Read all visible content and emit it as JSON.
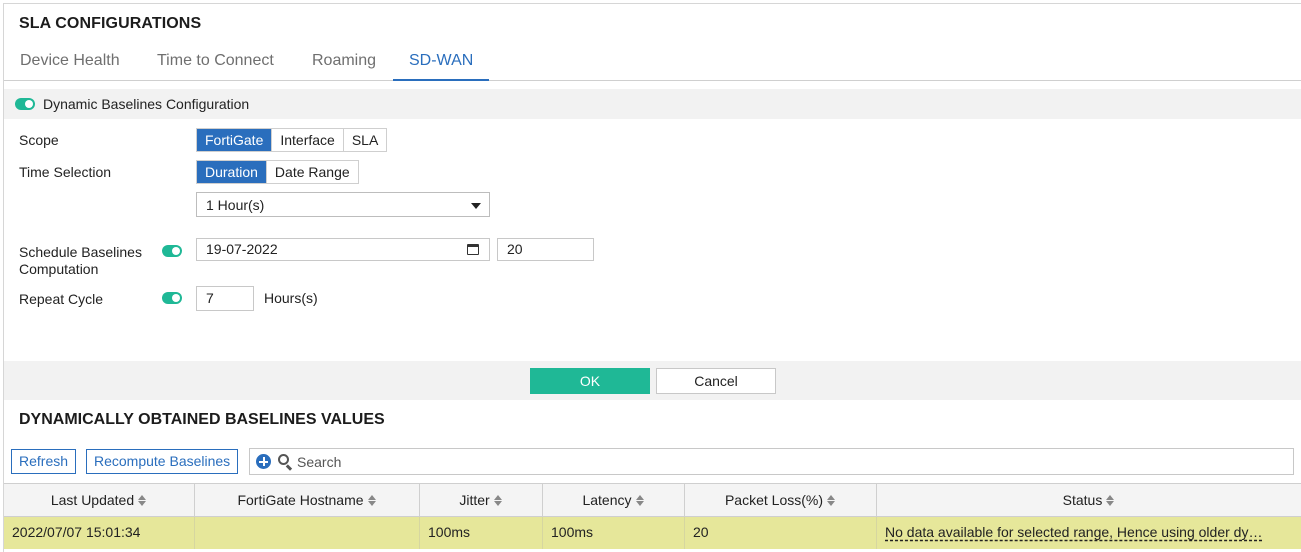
{
  "header": {
    "title": "SLA CONFIGURATIONS"
  },
  "tabs": [
    {
      "label": "Device Health",
      "active": false
    },
    {
      "label": "Time to Connect",
      "active": false
    },
    {
      "label": "Roaming",
      "active": false
    },
    {
      "label": "SD-WAN",
      "active": true
    }
  ],
  "config": {
    "section_label": "Dynamic Baselines Configuration",
    "section_enabled": true,
    "scope": {
      "label": "Scope",
      "options": [
        "FortiGate",
        "Interface",
        "SLA"
      ],
      "selected": "FortiGate"
    },
    "time_selection": {
      "label": "Time Selection",
      "options": [
        "Duration",
        "Date Range"
      ],
      "selected": "Duration",
      "duration_value": "1 Hour(s)"
    },
    "schedule": {
      "label": "Schedule Baselines Computation",
      "enabled": true,
      "date": "19-07-2022",
      "hour": "20"
    },
    "repeat": {
      "label": "Repeat Cycle",
      "enabled": true,
      "value": "7",
      "units": "Hours(s)"
    }
  },
  "actions": {
    "ok_label": "OK",
    "cancel_label": "Cancel"
  },
  "baselines": {
    "title": "DYNAMICALLY OBTAINED BASELINES VALUES",
    "refresh_label": "Refresh",
    "recompute_label": "Recompute Baselines",
    "search_placeholder": "Search",
    "columns": [
      "Last Updated",
      "FortiGate Hostname",
      "Jitter",
      "Latency",
      "Packet Loss(%)",
      "Status"
    ],
    "rows": [
      [
        "2022/07/07 15:01:34",
        "",
        "100ms",
        "100ms",
        "20",
        "No data available for selected range, Hence using older dy…"
      ]
    ]
  },
  "colors": {
    "accent": "#2a6ebd",
    "toggle_on": "#1fb896",
    "ok_button": "#1fb896",
    "row_highlight": "#e6e79a"
  }
}
